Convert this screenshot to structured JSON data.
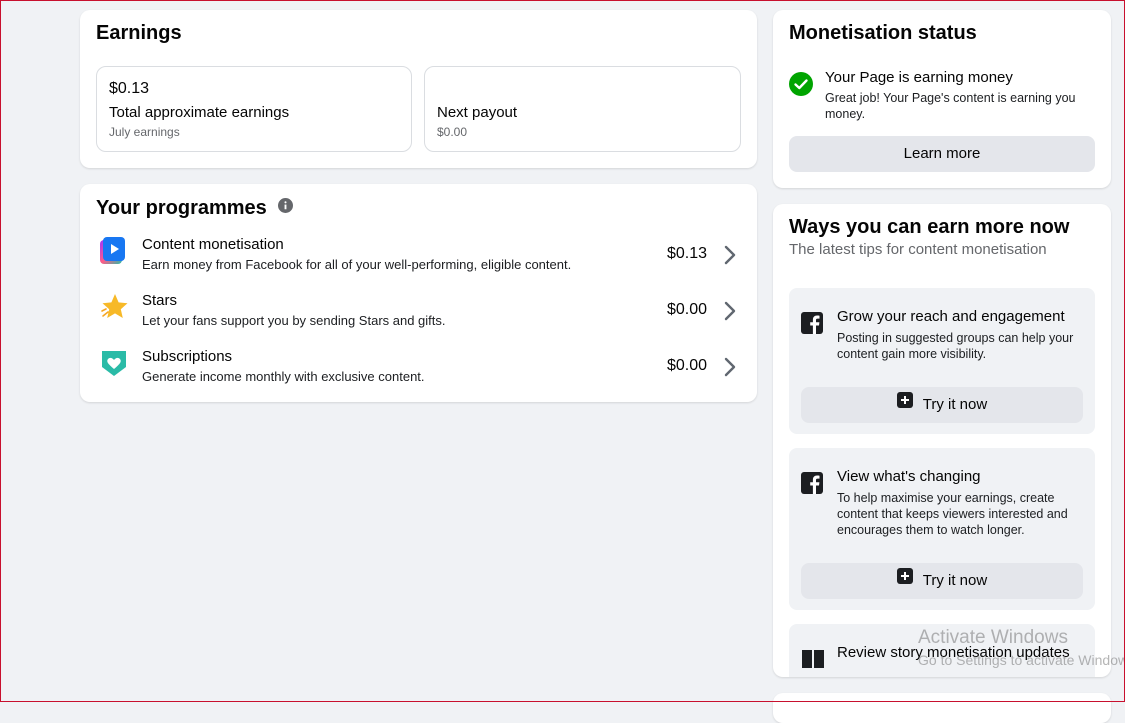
{
  "earnings": {
    "title": "Earnings",
    "total": {
      "amount": "$0.13",
      "label": "Total approximate earnings",
      "sub": "July earnings"
    },
    "payout": {
      "label": "Next payout",
      "sub": "$0.00"
    }
  },
  "programmes": {
    "title": "Your programmes",
    "items": [
      {
        "title": "Content monetisation",
        "desc": "Earn money from Facebook for all of your well-performing, eligible content.",
        "amount": "$0.13"
      },
      {
        "title": "Stars",
        "desc": "Let your fans support you by sending Stars and gifts.",
        "amount": "$0.00"
      },
      {
        "title": "Subscriptions",
        "desc": "Generate income monthly with exclusive content.",
        "amount": "$0.00"
      }
    ]
  },
  "status": {
    "title": "Monetisation status",
    "headline": "Your Page is earning money",
    "body": "Great job! Your Page's content is earning you money.",
    "button": "Learn more"
  },
  "ways": {
    "title": "Ways you can earn more now",
    "subtitle": "The latest tips for content monetisation",
    "tips": [
      {
        "title": "Grow your reach and engagement",
        "body": "Posting in suggested groups can help your content gain more visibility.",
        "button": "Try it now"
      },
      {
        "title": "View what's changing",
        "body": "To help maximise your earnings, create content that keeps viewers interested and encourages them to watch longer.",
        "button": "Try it now"
      },
      {
        "title": "Review story monetisation updates"
      }
    ]
  },
  "watermark": {
    "line1": "Activate Windows",
    "line2": "Go to Settings to activate Windows."
  },
  "colors": {
    "success": "#00a400",
    "facebook": "#1c1e21",
    "accent_blue": "#1877f2"
  }
}
